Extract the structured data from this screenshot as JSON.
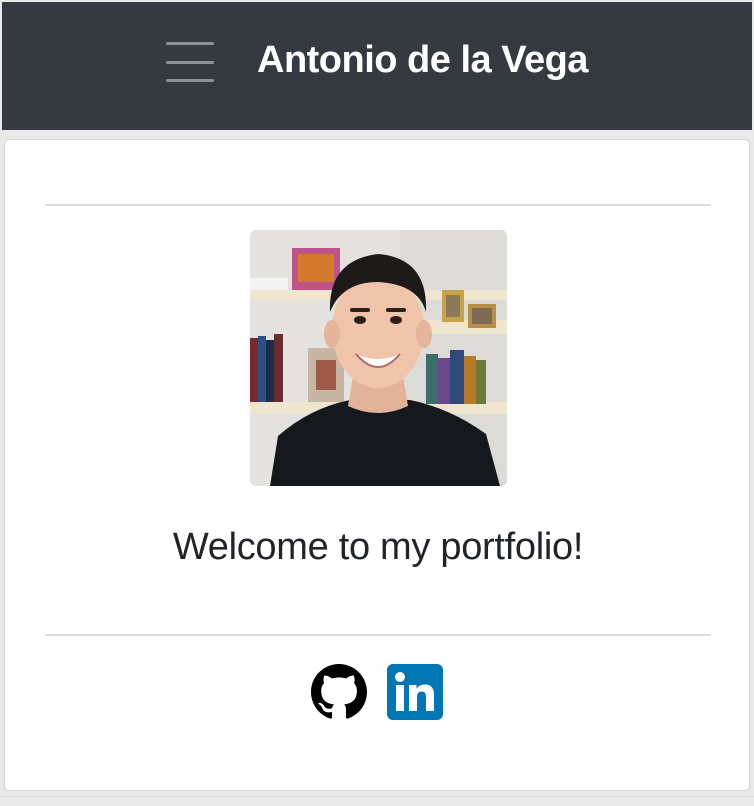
{
  "navbar": {
    "brand": "Antonio de la Vega",
    "menu_icon": "hamburger-menu-icon"
  },
  "main": {
    "welcome_text": "Welcome to my portfolio!",
    "avatar_alt": "profile photo",
    "socials": [
      {
        "icon": "github-icon",
        "color": "#000000"
      },
      {
        "icon": "linkedin-icon",
        "color": "#0077b5"
      }
    ]
  },
  "colors": {
    "navbar_bg": "#343a40",
    "brand_text": "#ffffff",
    "page_bg": "#e9e9e9",
    "card_bg": "#ffffff"
  }
}
